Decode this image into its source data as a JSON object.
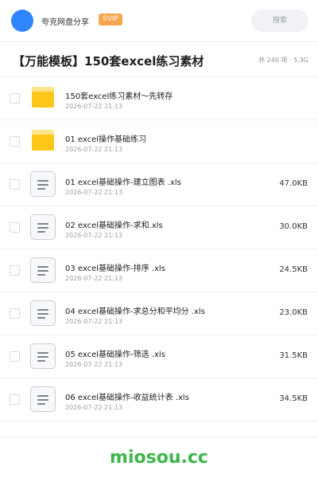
{
  "header": {
    "share_title": "夸克网盘分享",
    "badge": "SVIP",
    "search_placeholder": "搜索"
  },
  "folder": {
    "title": "【万能模板】150套excel练习素材",
    "meta": "共 240 项 · 5.3G"
  },
  "files": [
    {
      "type": "folder",
      "name": "150套excel练习素材～先转存",
      "date": "2026-07-22 21:13",
      "size": ""
    },
    {
      "type": "folder",
      "name": "01 excel操作基础练习",
      "date": "2026-07-22 21:13",
      "size": ""
    },
    {
      "type": "file",
      "name": "01 excel基础操作-建立图表 .xls",
      "date": "2026-07-22 21:13",
      "size": "47.0KB"
    },
    {
      "type": "file",
      "name": "02 excel基础操作-求和.xls",
      "date": "2026-07-22 21:13",
      "size": "30.0KB"
    },
    {
      "type": "file",
      "name": "03 excel基础操作-排序 .xls",
      "date": "2026-07-22 21:13",
      "size": "24.5KB"
    },
    {
      "type": "file",
      "name": "04 excel基础操作-求总分和平均分 .xls",
      "date": "2026-07-22 21:13",
      "size": "23.0KB"
    },
    {
      "type": "file",
      "name": "05 excel基础操作-筛选 .xls",
      "date": "2026-07-22 21:13",
      "size": "31.5KB"
    },
    {
      "type": "file",
      "name": "06 excel基础操作-收益统计表 .xls",
      "date": "2026-07-22 21:13",
      "size": "34.5KB"
    }
  ],
  "watermark": "miosou.cc",
  "icons": {
    "folder": "folder-icon",
    "file": "document-icon"
  },
  "colors": {
    "avatar": "#2f86ff",
    "svip": "#f7a44a",
    "folder": "#ffc61a",
    "watermark": "#3cb64b"
  }
}
